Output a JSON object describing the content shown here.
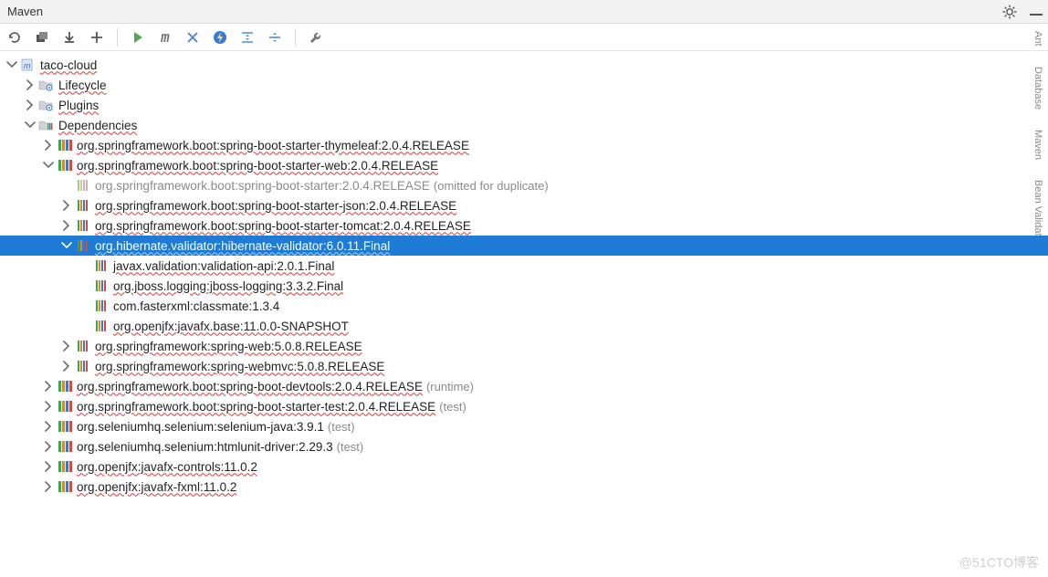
{
  "title": "Maven",
  "watermark": "@51CTO博客",
  "side_tabs": {
    "a": "Ant",
    "b": "Database",
    "c": "Maven",
    "d": "Bean Validation"
  },
  "tree": {
    "root": {
      "label": "taco-cloud"
    },
    "lifecycle": {
      "label": "Lifecycle"
    },
    "plugins": {
      "label": "Plugins"
    },
    "dependencies": {
      "label": "Dependencies"
    },
    "deps": [
      {
        "label": "org.springframework.boot:spring-boot-starter-thymeleaf:2.0.4.RELEASE"
      },
      {
        "label": "org.springframework.boot:spring-boot-starter-web:2.0.4.RELEASE"
      },
      {
        "label": "org.springframework.boot:spring-boot-devtools:2.0.4.RELEASE",
        "suffix": "(runtime)"
      },
      {
        "label": "org.springframework.boot:spring-boot-starter-test:2.0.4.RELEASE",
        "suffix": "(test)"
      },
      {
        "label": "org.seleniumhq.selenium:selenium-java:3.9.1",
        "suffix": "(test)"
      },
      {
        "label": "org.seleniumhq.selenium:htmlunit-driver:2.29.3",
        "suffix": "(test)"
      },
      {
        "label": "org.openjfx:javafx-controls:11.0.2"
      },
      {
        "label": "org.openjfx:javafx-fxml:11.0.2"
      }
    ],
    "web_children": [
      {
        "label": "org.springframework.boot:spring-boot-starter:2.0.4.RELEASE",
        "suffix": "(omitted for duplicate)",
        "dim": true
      },
      {
        "label": "org.springframework.boot:spring-boot-starter-json:2.0.4.RELEASE"
      },
      {
        "label": "org.springframework.boot:spring-boot-starter-tomcat:2.0.4.RELEASE"
      },
      {
        "label": "org.hibernate.validator:hibernate-validator:6.0.11.Final",
        "selected": true
      },
      {
        "label": "org.springframework:spring-web:5.0.8.RELEASE"
      },
      {
        "label": "org.springframework:spring-webmvc:5.0.8.RELEASE"
      }
    ],
    "hibernate_children": [
      {
        "label": "javax.validation:validation-api:2.0.1.Final"
      },
      {
        "label": "org.jboss.logging:jboss-logging:3.3.2.Final"
      },
      {
        "label": "com.fasterxml:classmate:1.3.4"
      },
      {
        "label": "org.openjfx:javafx.base:11.0.0-SNAPSHOT"
      }
    ]
  }
}
